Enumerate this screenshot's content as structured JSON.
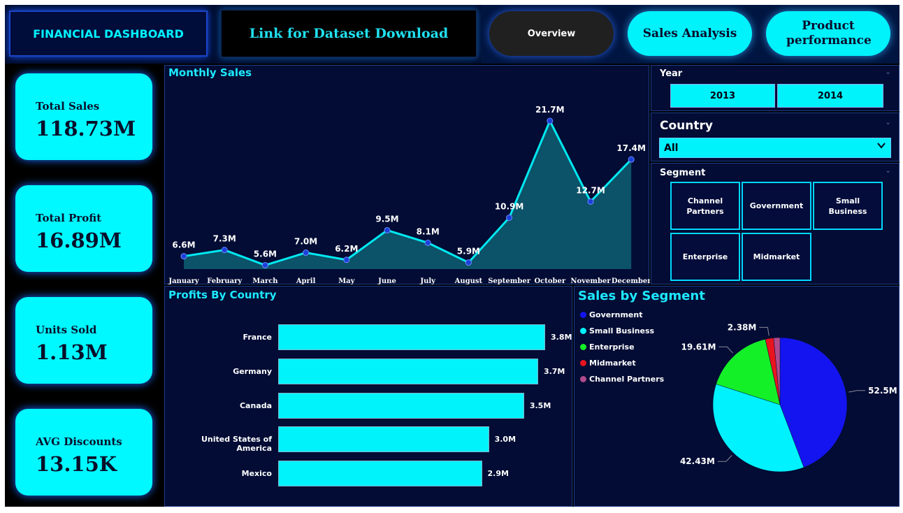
{
  "header": {
    "title": "FINANCIAL DASHBOARD",
    "link_text": "Link for Dataset Download",
    "nav": {
      "overview": "Overview",
      "sales_analysis": "Sales Analysis",
      "product_performance": "Product performance"
    }
  },
  "kpis": [
    {
      "label": "Total Sales",
      "value": "118.73M"
    },
    {
      "label": "Total Profit",
      "value": "16.89M"
    },
    {
      "label": "Units Sold",
      "value": "1.13M"
    },
    {
      "label": "AVG Discounts",
      "value": "13.15K"
    }
  ],
  "filters": {
    "year": {
      "label": "Year",
      "options": [
        "2013",
        "2014"
      ]
    },
    "country": {
      "label": "Country",
      "selected": "All"
    },
    "segment": {
      "label": "Segment",
      "options": [
        "Channel Partners",
        "Government",
        "Small Business",
        "Enterprise",
        "Midmarket"
      ]
    }
  },
  "colors": {
    "accent": "#00f2fb",
    "line": "#00e8f0",
    "area": "#0e5f72",
    "point": "#1b3fd8",
    "panel": "#020c34"
  },
  "chart_data": [
    {
      "type": "area",
      "title": "Monthly Sales",
      "categories": [
        "January",
        "February",
        "March",
        "April",
        "May",
        "June",
        "July",
        "August",
        "September",
        "October",
        "November",
        "December"
      ],
      "values": [
        6.6,
        7.3,
        5.6,
        7.0,
        6.2,
        9.5,
        8.1,
        5.9,
        10.9,
        21.7,
        12.7,
        17.4
      ],
      "labels": [
        "6.6M",
        "7.3M",
        "5.6M",
        "7.0M",
        "6.2M",
        "9.5M",
        "8.1M",
        "5.9M",
        "10.9M",
        "21.7M",
        "12.7M",
        "17.4M"
      ],
      "ylim": [
        4.7,
        21.7
      ],
      "grid": false
    },
    {
      "type": "bar",
      "orientation": "horizontal",
      "title": "Profits By Country",
      "categories": [
        "France",
        "Germany",
        "Canada",
        "United States of America",
        "Mexico"
      ],
      "values": [
        3.8,
        3.7,
        3.5,
        3.0,
        2.9
      ],
      "labels": [
        "3.8M",
        "3.7M",
        "3.5M",
        "3.0M",
        "2.9M"
      ],
      "grid": false
    },
    {
      "type": "pie",
      "title": "Sales by Segment",
      "categories": [
        "Government",
        "Small Business",
        "Enterprise",
        "Midmarket",
        "Channel Partners"
      ],
      "values": [
        52.5,
        42.43,
        19.61,
        2.38,
        1.8
      ],
      "labels": [
        "52.5M",
        "42.43M",
        "19.61M",
        "2.38M",
        ""
      ],
      "colors": [
        "#1414f0",
        "#00f2ff",
        "#14f028",
        "#e8141e",
        "#b04a8c"
      ],
      "legend": "top-left"
    }
  ]
}
